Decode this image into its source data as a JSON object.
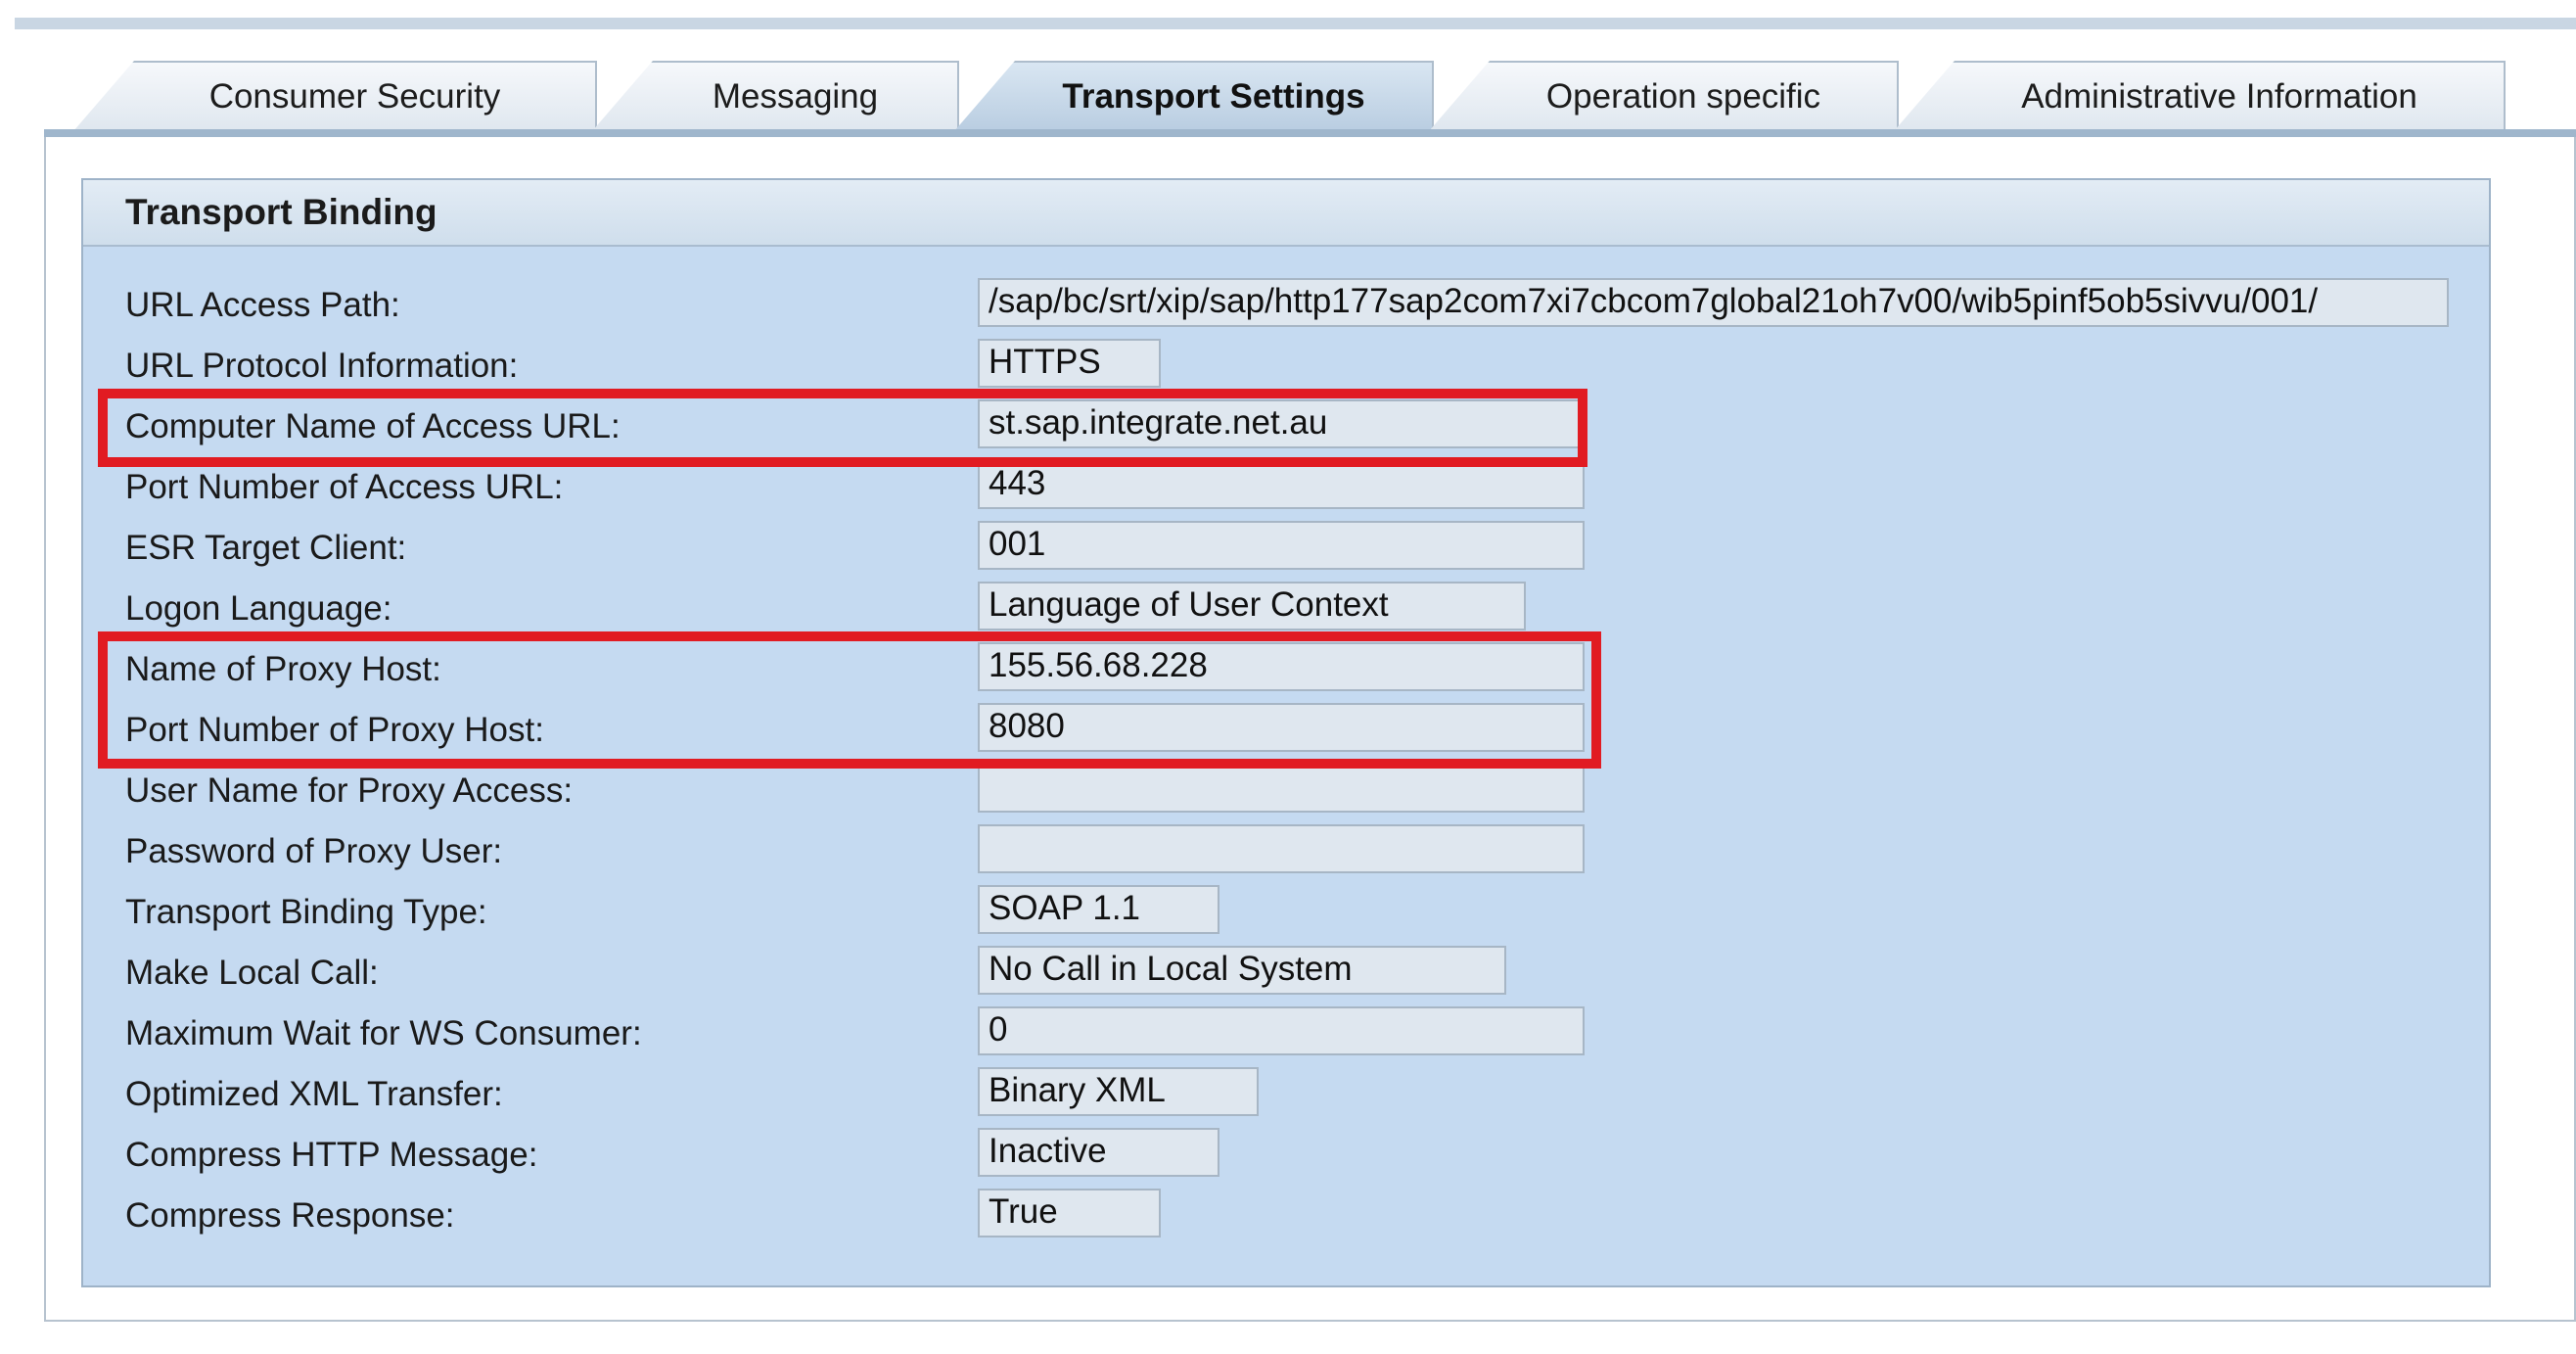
{
  "tabs": [
    {
      "label": "Consumer Security",
      "active": false
    },
    {
      "label": "Messaging",
      "active": false
    },
    {
      "label": "Transport Settings",
      "active": true
    },
    {
      "label": "Operation specific",
      "active": false
    },
    {
      "label": "Administrative Information",
      "active": false
    }
  ],
  "group": {
    "title": "Transport Binding",
    "fields": [
      {
        "label": "URL Access Path:",
        "value": "/sap/bc/srt/xip/sap/http177sap2com7xi7cbcom7global21oh7v00/wib5pinf5ob5sivvu/001/"
      },
      {
        "label": "URL Protocol Information:",
        "value": "HTTPS"
      },
      {
        "label": "Computer Name of Access URL:",
        "value": "st.sap.integrate.net.au"
      },
      {
        "label": "Port Number of Access URL:",
        "value": "443"
      },
      {
        "label": "ESR Target Client:",
        "value": "001"
      },
      {
        "label": "Logon Language:",
        "value": "Language of User Context"
      },
      {
        "label": "Name of Proxy Host:",
        "value": "155.56.68.228"
      },
      {
        "label": "Port Number of Proxy Host:",
        "value": "8080"
      },
      {
        "label": "User Name for Proxy Access:",
        "value": ""
      },
      {
        "label": "Password of Proxy User:",
        "value": ""
      },
      {
        "label": "Transport Binding Type:",
        "value": "SOAP 1.1"
      },
      {
        "label": "Make Local Call:",
        "value": "No Call in Local System"
      },
      {
        "label": "Maximum Wait for WS Consumer:",
        "value": "0"
      },
      {
        "label": "Optimized XML Transfer:",
        "value": "Binary XML"
      },
      {
        "label": "Compress HTTP Message:",
        "value": "Inactive"
      },
      {
        "label": "Compress Response:",
        "value": "True"
      }
    ]
  },
  "colors": {
    "highlight": "#e11b22",
    "group_background": "#c5daf1",
    "field_background": "#dfe7ef"
  }
}
